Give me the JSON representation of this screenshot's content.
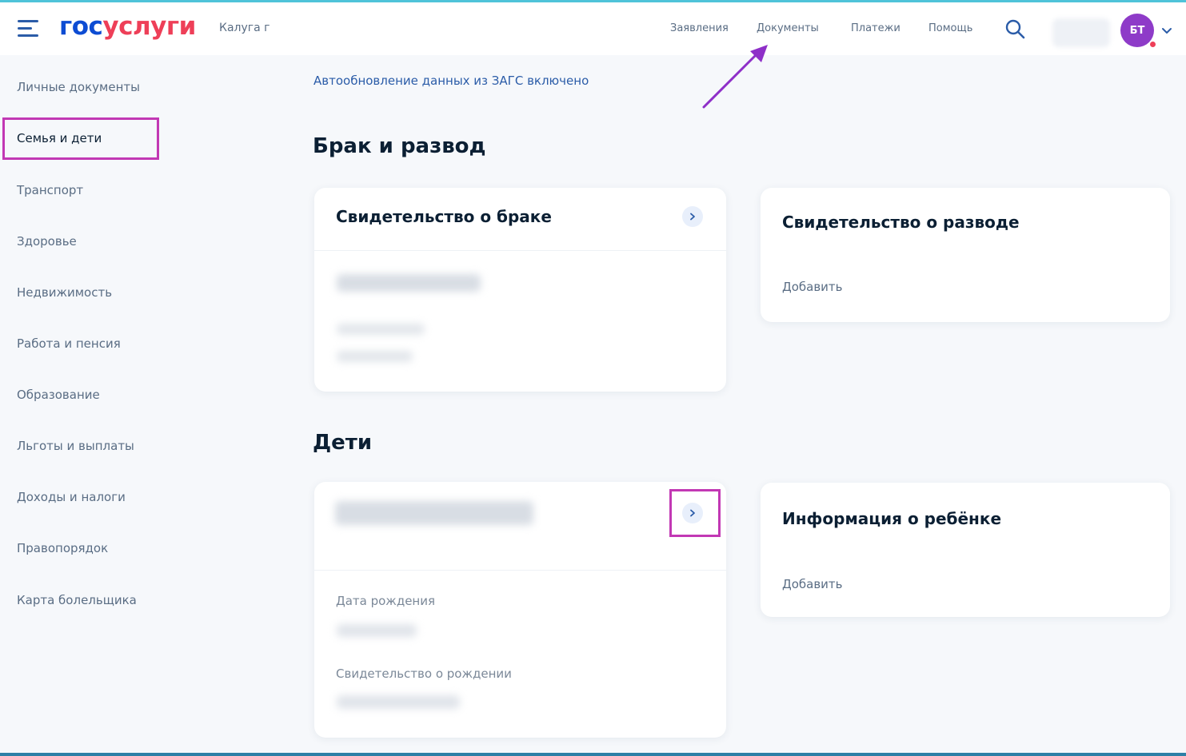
{
  "header": {
    "logo_part1": "гос",
    "logo_part2": "услуги",
    "city": "Калуга г",
    "nav": [
      "Заявления",
      "Документы",
      "Платежи",
      "Помощь"
    ],
    "avatar_initials": "БТ",
    "icons": {
      "menu": "hamburger-icon",
      "search": "search-icon",
      "dropdown": "chevron-down-icon"
    }
  },
  "sidebar": {
    "items": [
      "Личные документы",
      "Семья и дети",
      "Транспорт",
      "Здоровье",
      "Недвижимость",
      "Работа и пенсия",
      "Образование",
      "Льготы и выплаты",
      "Доходы и налоги",
      "Правопорядок",
      "Карта болельщика"
    ],
    "active": "Семья и дети"
  },
  "main": {
    "zags_notice": "Автообновление данных из ЗАГС включено",
    "marriage": {
      "section_title": "Брак и развод",
      "marriage_card_title": "Свидетельство о браке",
      "divorce_card_title": "Свидетельство о разводе",
      "divorce_add": "Добавить"
    },
    "children": {
      "section_title": "Дети",
      "birth_date_label": "Дата рождения",
      "birth_cert_label": "Свидетельство о рождении",
      "info_card_title": "Информация о ребёнке",
      "info_add": "Добавить"
    }
  },
  "colors": {
    "brand_blue": "#0d4cd3",
    "brand_red": "#ee3f58",
    "highlight": "#c238b4",
    "avatar": "#8e3bc8"
  }
}
